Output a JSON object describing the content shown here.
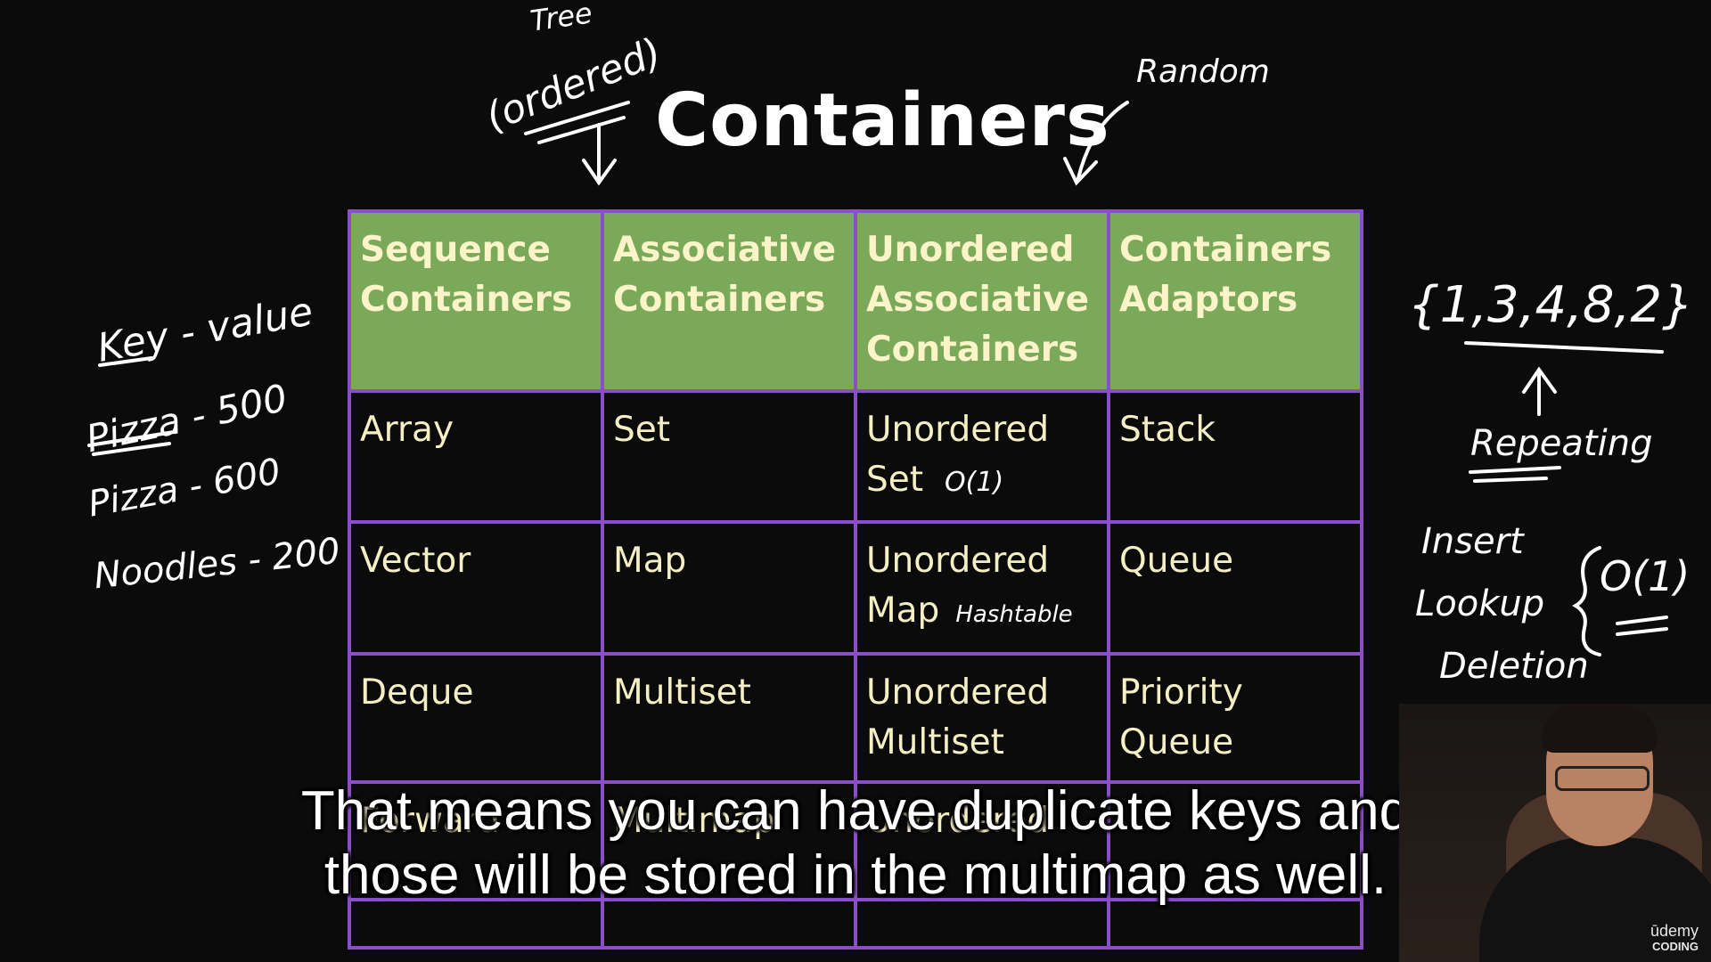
{
  "title": "Containers",
  "handwriting": {
    "tree": "Tree",
    "ordered": "(ordered)",
    "random": "Random",
    "key_value": "Key - value",
    "pizza_500": "Pizza - 500",
    "pizza_600": "Pizza - 600",
    "noodles_200": "Noodles - 200",
    "set_example": "{1,3,4,8,2}",
    "repeating": "Repeating",
    "insert": "Insert",
    "lookup": "Lookup",
    "deletion": "Deletion",
    "o1_right": "O(1)",
    "o1_set": "O(1)",
    "hashtable": "Hashtable"
  },
  "table": {
    "headers": [
      [
        "Sequence",
        "Containers"
      ],
      [
        "Associative",
        "Containers"
      ],
      [
        "Unordered",
        "Associative",
        "Containers"
      ],
      [
        "Containers",
        "Adaptors"
      ]
    ],
    "rows": [
      [
        [
          "Array"
        ],
        [
          "Set"
        ],
        [
          "Unordered",
          "Set"
        ],
        [
          "Stack"
        ]
      ],
      [
        [
          "Vector"
        ],
        [
          "Map"
        ],
        [
          "Unordered",
          "Map"
        ],
        [
          "Queue"
        ]
      ],
      [
        [
          "Deque"
        ],
        [
          "Multiset"
        ],
        [
          "Unordered",
          "Multiset"
        ],
        [
          "Priority",
          "Queue"
        ]
      ],
      [
        [
          "Forward"
        ],
        [
          "Multimap"
        ],
        [
          "Unordered"
        ],
        [
          ""
        ]
      ]
    ]
  },
  "subtitle": {
    "line1": "That means you can have duplicate keys and",
    "line2": "those will be stored in the multimap as well."
  },
  "watermark": {
    "brand": "ūdemy",
    "sub": "CODING"
  }
}
